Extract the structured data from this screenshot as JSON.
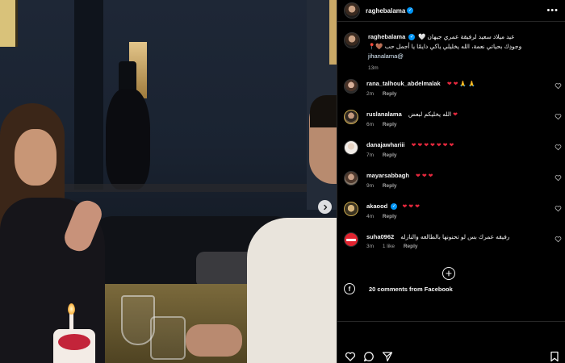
{
  "post": {
    "username": "raghebalama",
    "verified": true
  },
  "caption": {
    "username": "raghebalama",
    "line1": "عيد ميلاد سعيد لرفيقة عمري جيهان 🤍",
    "line2": "وجودِك بحياتي نعمة، الله يخليلي ياكي دايمًا يا أجمل حب 🤎📍",
    "mention": "@jihanalama",
    "time": "13m"
  },
  "comments": [
    {
      "username": "rana_talhouk_abdelmalak",
      "text": "",
      "emoji": "❤ ❤ 🙏 🙏",
      "time": "2m",
      "likes": "",
      "reply_label": "Reply"
    },
    {
      "username": "ruslanalama",
      "text": "الله يخليكم لبعض",
      "emoji": "❤",
      "time": "6m",
      "likes": "",
      "reply_label": "Reply"
    },
    {
      "username": "danajawhariii",
      "text": "",
      "emoji": "❤ ❤ ❤ ❤ ❤ ❤ ❤",
      "time": "7m",
      "likes": "",
      "reply_label": "Reply"
    },
    {
      "username": "mayarsabbagh",
      "text": "",
      "emoji": "❤ ❤ ❤",
      "time": "9m",
      "likes": "",
      "reply_label": "Reply"
    },
    {
      "username": "akaood",
      "text": "",
      "emoji": "❤ ❤ ❤",
      "time": "4m",
      "likes": "",
      "reply_label": "Reply"
    },
    {
      "username": "suha0962",
      "text": "رفيقه عمرك بس لو تحنونها بالطالعه والنازله",
      "emoji": "",
      "time": "3m",
      "likes": "1 like",
      "reply_label": "Reply"
    }
  ],
  "facebook": {
    "label": "20 comments from Facebook"
  },
  "icons": {
    "more": "more-options-icon",
    "next": "chevron-right-icon",
    "like": "heart-outline-icon",
    "comment": "comment-icon",
    "share": "share-icon",
    "save": "bookmark-icon",
    "facebook": "facebook-icon"
  },
  "colors": {
    "verified": "#0095f6",
    "heart": "#e5283d",
    "muted": "#a8a8a8",
    "background": "#000000"
  }
}
